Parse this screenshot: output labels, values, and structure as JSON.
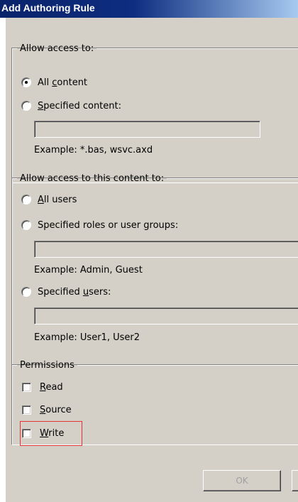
{
  "window": {
    "title": "Add Authoring Rule"
  },
  "access": {
    "legend": "Allow access to:",
    "all_content": {
      "prefix": "All ",
      "accel": "c",
      "rest": "ontent",
      "checked": true
    },
    "specified_content": {
      "prefix": "",
      "accel": "S",
      "rest": "pecified content:",
      "checked": false
    },
    "content_input_value": "",
    "example": "Example: *.bas, wsvc.axd"
  },
  "users": {
    "legend": "Allow access to this content to:",
    "all_users": {
      "prefix": "",
      "accel": "A",
      "rest": "ll users",
      "checked": false
    },
    "roles": {
      "prefix": "Specified roles or user ",
      "accel": "g",
      "rest": "roups:",
      "checked": false
    },
    "roles_input_value": "",
    "roles_example": "Example: Admin, Guest",
    "specified_users": {
      "prefix": "Specified ",
      "accel": "u",
      "rest": "sers:",
      "checked": false
    },
    "users_input_value": "",
    "users_example": "Example: User1, User2"
  },
  "permissions": {
    "legend": "Permissions",
    "read": {
      "prefix": "",
      "accel": "R",
      "rest": "ead",
      "checked": false
    },
    "source": {
      "prefix": "",
      "accel": "S",
      "rest": "ource",
      "checked": false
    },
    "write": {
      "prefix": "",
      "accel": "W",
      "rest": "rite",
      "checked": false
    }
  },
  "buttons": {
    "ok_label": "OK",
    "ok_enabled": false
  },
  "colors": {
    "title_bar": "#0a246a",
    "dialog_face": "#d4d0c8",
    "highlight_box": "#e53333"
  }
}
